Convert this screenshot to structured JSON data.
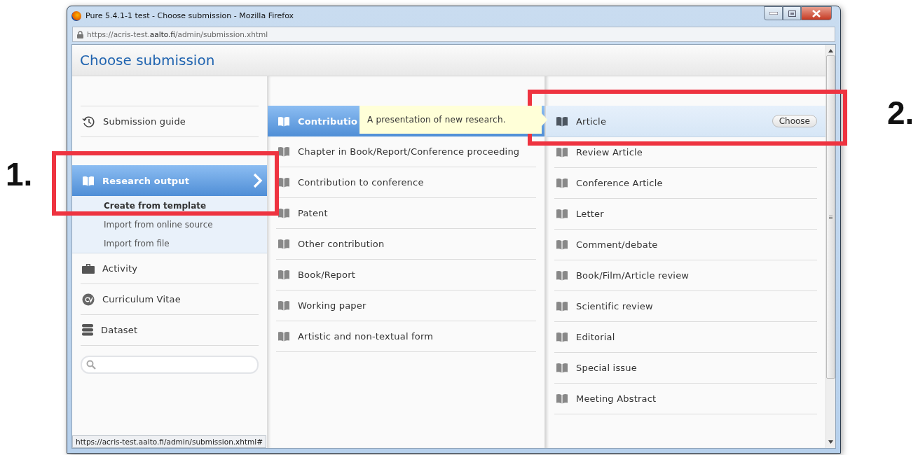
{
  "window": {
    "title": "Pure 5.4.1-1 test - Choose submission - Mozilla Firefox",
    "url_prefix": "https://acris-test.",
    "url_domain": "aalto.fi",
    "url_path": "/admin/submission.xhtml"
  },
  "dialog": {
    "title": "Choose submission"
  },
  "guide": {
    "label": "Submission guide"
  },
  "categories": [
    {
      "kind": "book",
      "label": "Research output",
      "selected": true,
      "children": [
        {
          "label": "Create from template",
          "selected": true
        },
        {
          "label": "Import from online source",
          "selected": false
        },
        {
          "label": "Import from file",
          "selected": false
        }
      ]
    },
    {
      "kind": "briefcase",
      "label": "Activity",
      "selected": false
    },
    {
      "kind": "cv",
      "label": "Curriculum Vitae",
      "selected": false
    },
    {
      "kind": "database",
      "label": "Dataset",
      "selected": false
    }
  ],
  "types": [
    {
      "label": "Contributio",
      "selected": true
    },
    {
      "label": "Chapter in Book/Report/Conference proceeding",
      "selected": false
    },
    {
      "label": "Contribution to conference",
      "selected": false
    },
    {
      "label": "Patent",
      "selected": false
    },
    {
      "label": "Other contribution",
      "selected": false
    },
    {
      "label": "Book/Report",
      "selected": false
    },
    {
      "label": "Working paper",
      "selected": false
    },
    {
      "label": "Artistic and non-textual form",
      "selected": false
    }
  ],
  "tooltip": "A presentation of new research.",
  "subtypes": [
    {
      "label": "Article",
      "selected": true
    },
    {
      "label": "Review Article",
      "selected": false
    },
    {
      "label": "Conference Article",
      "selected": false
    },
    {
      "label": "Letter",
      "selected": false
    },
    {
      "label": "Comment/debate",
      "selected": false
    },
    {
      "label": "Book/Film/Article review",
      "selected": false
    },
    {
      "label": "Scientific review",
      "selected": false
    },
    {
      "label": "Editorial",
      "selected": false
    },
    {
      "label": "Special issue",
      "selected": false
    },
    {
      "label": "Meeting Abstract",
      "selected": false
    }
  ],
  "choose_button": "Choose",
  "status_url": "https://acris-test.aalto.fi/admin/submission.xhtml#",
  "annotations": [
    {
      "label": "1."
    },
    {
      "label": "2."
    }
  ]
}
